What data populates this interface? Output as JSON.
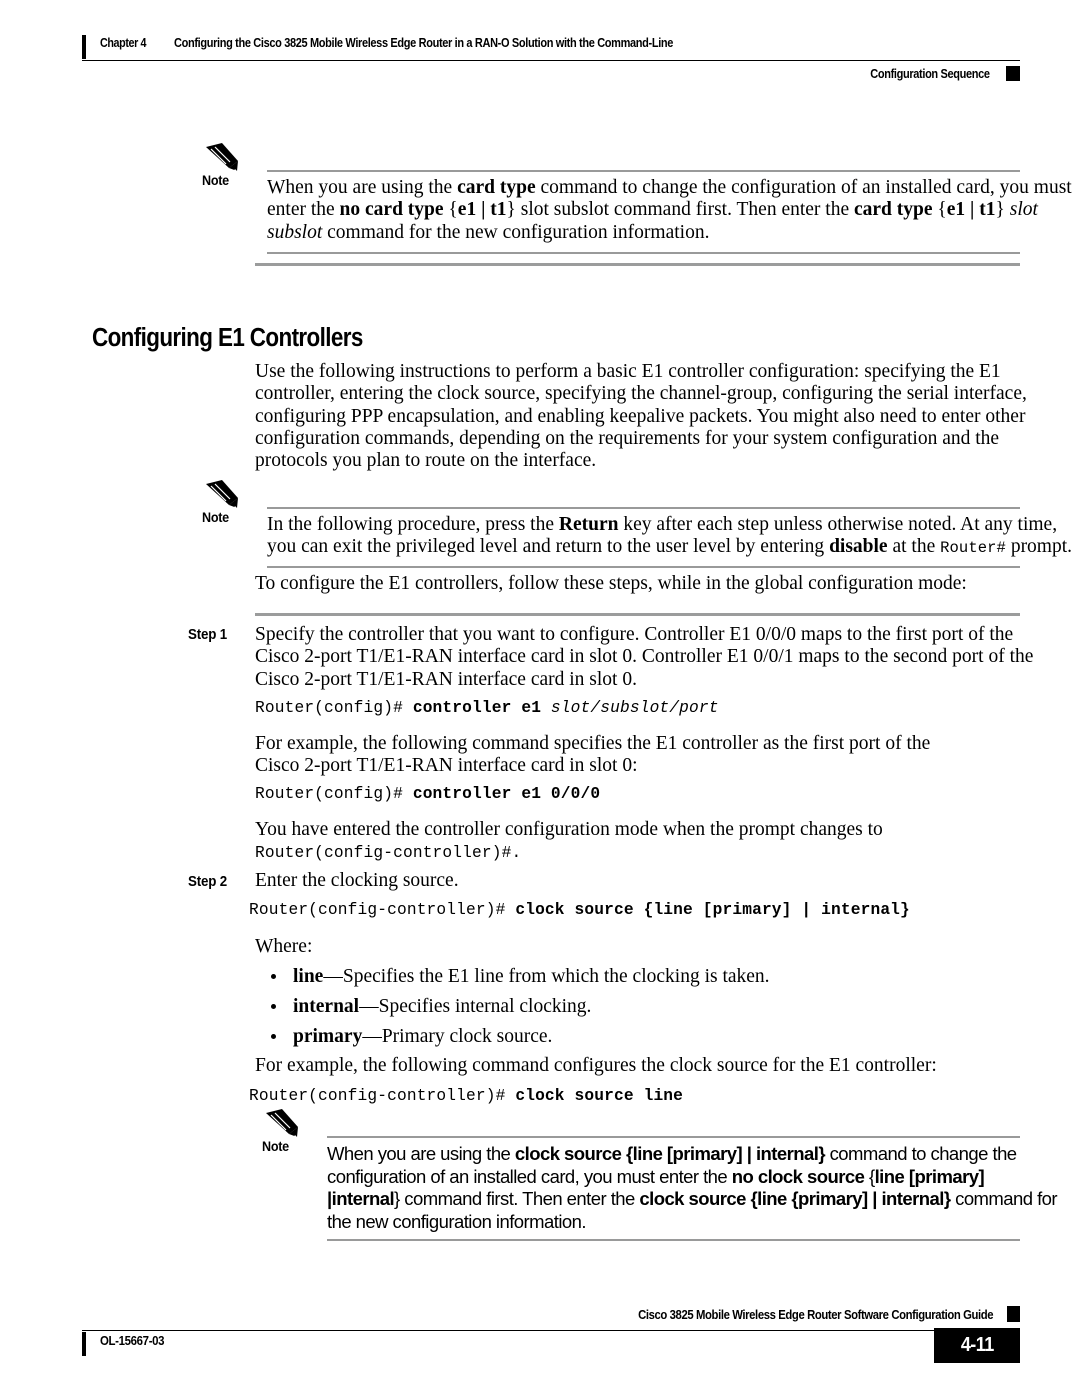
{
  "header": {
    "chapter": "Chapter 4",
    "title": "Configuring the Cisco 3825 Mobile Wireless Edge Router in a RAN-O Solution with the Command-Line",
    "section": "Configuration Sequence"
  },
  "notes": {
    "label": "Note",
    "note1": {
      "line1_a": "When you are using the ",
      "line1_b": "card type",
      "line1_c": " command to change the configuration of an installed card, you must",
      "line2_a": "enter the ",
      "line2_b": "no card type",
      "line2_c": " {",
      "line2_d": "e1 | t1",
      "line2_e": "} slot subslot command first. Then enter the ",
      "line2_f": "card type",
      "line2_g": " {",
      "line2_h": "e1 | t1",
      "line2_i": "} ",
      "line2_j": "slot",
      "line3_a": "subslot",
      "line3_b": " command for the new configuration information."
    },
    "note2": {
      "line1_a": "In the following procedure, press the ",
      "line1_b": "Return",
      "line1_c": " key after each step unless otherwise noted. At any time,",
      "line2_a": "you can exit the privileged level and return to the user level by entering ",
      "line2_b": "disable",
      "line2_c": " at the ",
      "line2_d": "Router#",
      "line2_e": " prompt."
    },
    "note3": {
      "line1_a": "When you are using the ",
      "line1_b": "clock source {line [primary] | internal}",
      "line1_c": " command to change the",
      "line2_a": "configuration of an installed card, you must enter the ",
      "line2_b": "no clock source",
      "line2_c": " {",
      "line2_d": "line [primary]",
      "line3_a": "|internal",
      "line3_b": "} command first. Then enter the ",
      "line3_c": "clock source {line {primary] | internal}",
      "line3_d": " command for",
      "line4_a": "the new configuration information."
    }
  },
  "heading": "Configuring E1 Controllers",
  "intro": {
    "line1": "Use the following instructions to perform a basic E1 controller configuration: specifying the E1",
    "line2": "controller, entering the clock source, specifying the channel-group, configuring the serial interface,",
    "line3": "configuring PPP encapsulation, and enabling keepalive packets. You might also need to enter other",
    "line4": "configuration commands, depending on the requirements for your system configuration and the",
    "line5": "protocols you plan to route on the interface."
  },
  "lead_in": "To configure the E1 controllers, follow these steps, while in the global configuration mode:",
  "steps": {
    "step1": {
      "label": "Step 1",
      "line1": "Specify the controller that you want to configure. Controller E1 0/0/0 maps to the first port of the",
      "line2": "Cisco 2-port T1/E1-RAN interface card in slot 0. Controller E1 0/0/1 maps to the second port of the",
      "line3": "Cisco 2-port T1/E1-RAN interface card in slot 0.",
      "cmd_prompt": "Router(config)# ",
      "cmd_bold": "controller e1",
      "cmd_italic": " slot/subslot/port",
      "example_line1": "For example, the following command specifies the E1 controller as the first port of the",
      "example_line2": "Cisco 2-port T1/E1-RAN interface card in slot 0:",
      "example_cmd_prompt": "Router(config)# ",
      "example_cmd_bold": "controller e1 0/0/0",
      "result_text": "You have entered the controller configuration mode when the prompt changes to",
      "result_code": "Router(config-controller)#."
    },
    "step2": {
      "label": "Step 2",
      "line1": "Enter the clocking source.",
      "cmd_prompt": "Router(config-controller)# ",
      "cmd_bold": "clock source {line [primary] | internal}",
      "where_label": "Where:",
      "bullets": [
        {
          "term": "line",
          "desc": "—Specifies the E1 line from which the clocking is taken."
        },
        {
          "term": "internal",
          "desc": "—Specifies internal clocking."
        },
        {
          "term": "primary",
          "desc": "—Primary clock source."
        }
      ],
      "example_line1": "For example, the following command configures the clock source for the E1 controller:",
      "example_cmd_prompt": "Router(config-controller)# ",
      "example_cmd_bold": "clock source line"
    }
  },
  "footer": {
    "guide": "Cisco 3825 Mobile Wireless Edge Router Software Configuration Guide",
    "doc_id": "OL-15667-03",
    "page_number": "4-11"
  }
}
